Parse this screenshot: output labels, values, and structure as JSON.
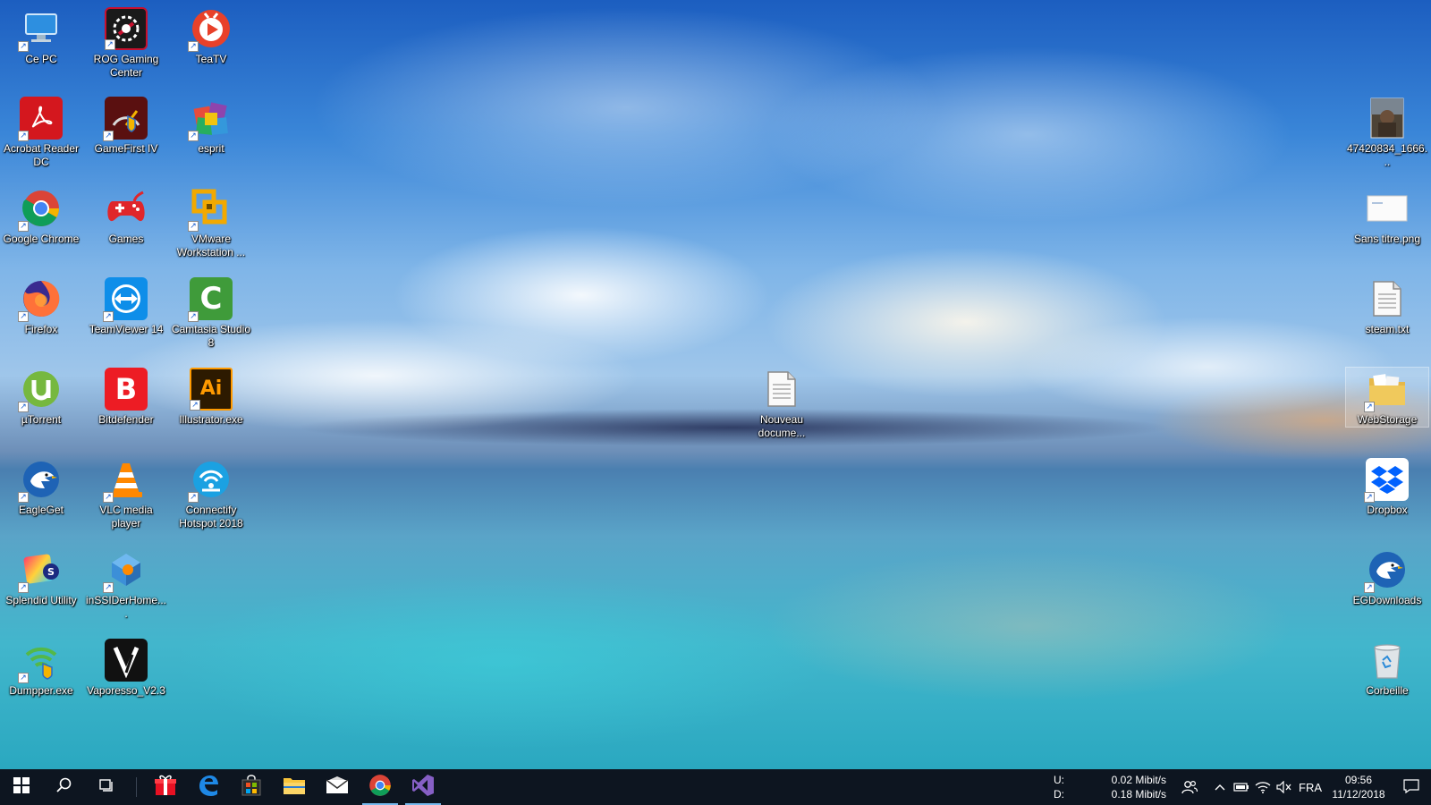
{
  "desktop": {
    "left_icons": [
      {
        "label": "Ce PC",
        "icon": "this-pc-icon",
        "color": "#3aa0e8"
      },
      {
        "label": "Acrobat Reader DC",
        "icon": "acrobat-reader-icon",
        "color": "#d4171e"
      },
      {
        "label": "Google Chrome",
        "icon": "chrome-icon",
        "color": "#4285f4"
      },
      {
        "label": "Firefox",
        "icon": "firefox-icon",
        "color": "#ff7139"
      },
      {
        "label": "µTorrent",
        "icon": "utorrent-icon",
        "color": "#76b83f"
      },
      {
        "label": "EagleGet",
        "icon": "eagleget-icon",
        "color": "#1e63b5"
      },
      {
        "label": "Splendid Utility",
        "icon": "splendid-utility-icon",
        "color": "#6a3bd0"
      },
      {
        "label": "Dumpper.exe",
        "icon": "dumpper-icon",
        "color": "#54b848"
      },
      {
        "label": "ROG Gaming Center",
        "icon": "rog-gaming-center-icon",
        "color": "#c8102e"
      },
      {
        "label": "GameFirst IV",
        "icon": "gamefirst-icon",
        "color": "#8b1a1a"
      },
      {
        "label": "Games",
        "icon": "games-icon",
        "color": "#e0262b"
      },
      {
        "label": "TeamViewer 14",
        "icon": "teamviewer-icon",
        "color": "#0e8ee9"
      },
      {
        "label": "Bitdefender",
        "icon": "bitdefender-icon",
        "color": "#ed1c24"
      },
      {
        "label": "VLC media player",
        "icon": "vlc-icon",
        "color": "#ff8800"
      },
      {
        "label": "inSSIDerHome....",
        "icon": "inssider-icon",
        "color": "#3c8fd8"
      },
      {
        "label": "Vaporesso_V2.3",
        "icon": "vaporesso-icon",
        "color": "#111111"
      },
      {
        "label": "TeaTV",
        "icon": "teatv-icon",
        "color": "#e8412a"
      },
      {
        "label": "esprit",
        "icon": "esprit-icon",
        "color": "#8e44ad"
      },
      {
        "label": "VMware Workstation ...",
        "icon": "vmware-icon",
        "color": "#f2a900"
      },
      {
        "label": "Camtasia Studio 8",
        "icon": "camtasia-icon",
        "color": "#3f9b3a"
      },
      {
        "label": "Illustrator.exe",
        "icon": "illustrator-icon",
        "color": "#ff9a00"
      },
      {
        "label": "Connectify Hotspot 2018",
        "icon": "connectify-icon",
        "color": "#1ba1e2"
      }
    ],
    "center_icons": [
      {
        "label": "Nouveau docume...",
        "icon": "text-document-icon",
        "color": "#f4f4f4"
      }
    ],
    "right_icons": [
      {
        "label": "47420834_1666...",
        "icon": "image-thumbnail-icon",
        "color": "#5a4a3a"
      },
      {
        "label": "Sans titre.png",
        "icon": "png-file-icon",
        "color": "#f4f4f4"
      },
      {
        "label": "steam.txt",
        "icon": "text-document-icon",
        "color": "#f4f4f4"
      },
      {
        "label": "WebStorage",
        "icon": "webstorage-folder-icon",
        "color": "#e6b84a"
      },
      {
        "label": "Dropbox",
        "icon": "dropbox-icon",
        "color": "#0061fe"
      },
      {
        "label": "EGDownloads",
        "icon": "eagleget-icon",
        "color": "#1e63b5"
      },
      {
        "label": "Corbeille",
        "icon": "recycle-bin-icon",
        "color": "#d8dde2"
      }
    ]
  },
  "taskbar": {
    "apps": [
      {
        "name": "start-button",
        "icon": "windows-icon"
      },
      {
        "name": "search-button",
        "icon": "search-icon"
      },
      {
        "name": "task-view-button",
        "icon": "task-view-icon"
      },
      {
        "name": "gift-app",
        "icon": "gift-icon",
        "color": "#e81123"
      },
      {
        "name": "edge-app",
        "icon": "edge-icon",
        "color": "#1e88e5"
      },
      {
        "name": "store-app",
        "icon": "store-icon"
      },
      {
        "name": "explorer-app",
        "icon": "folder-icon",
        "color": "#f8c43b"
      },
      {
        "name": "mail-app",
        "icon": "mail-icon"
      },
      {
        "name": "chrome-app",
        "icon": "chrome-icon",
        "active": true
      },
      {
        "name": "visual-studio-app",
        "icon": "visual-studio-icon",
        "color": "#865fc5",
        "active": true
      }
    ],
    "network": {
      "upload_label": "U:",
      "upload_value": "0.02 Mibit/s",
      "download_label": "D:",
      "download_value": "0.18 Mibit/s"
    },
    "language": "FRA",
    "time": "09:56",
    "date": "11/12/2018"
  }
}
